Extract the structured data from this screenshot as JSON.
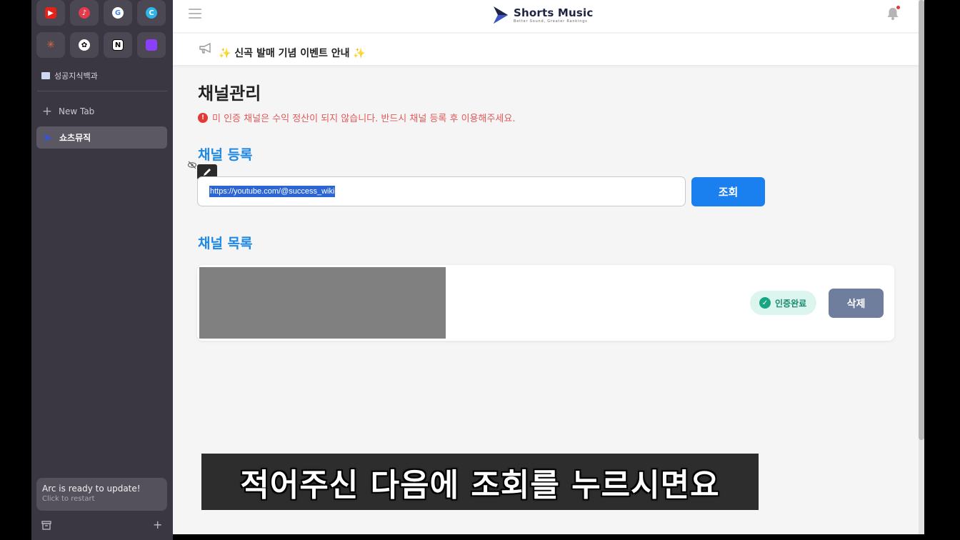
{
  "sidebar": {
    "favorites": [
      {
        "icon": "youtube-icon",
        "color": "#e62117"
      },
      {
        "icon": "music-app-icon",
        "color": "#e23b4b"
      },
      {
        "icon": "google-icon",
        "color": "#ffffff"
      },
      {
        "icon": "canva-icon",
        "color": "#2fb4e8"
      },
      {
        "icon": "claude-icon",
        "color": "#e2683f"
      },
      {
        "icon": "chatgpt-icon",
        "color": "#ffffff"
      },
      {
        "icon": "notion-icon",
        "color": "#ffffff"
      },
      {
        "icon": "purple-app-icon",
        "color": "#8a3ffc"
      }
    ],
    "folder_label": "성공지식백과",
    "new_tab_label": "New Tab",
    "active_tab_label": "쇼츠뮤직",
    "update_title": "Arc is ready to update!",
    "update_subtitle": "Click to restart"
  },
  "header": {
    "brand_name": "Shorts Music",
    "brand_tagline": "Better Sound, Greater Rankings"
  },
  "notice": {
    "text": "✨ 신곡 발매 기념 이벤트 안내 ✨"
  },
  "main": {
    "page_title": "채널관리",
    "warning": "미 인증 채널은 수익 정산이 되지 않습니다. 반드시 채널 등록 후 이용해주세요.",
    "register_title": "채널 등록",
    "url_value": "https://youtube.com/@success_wiki",
    "search_label": "조회",
    "list_title": "채널 목록",
    "channels": [
      {
        "status": "인증완료",
        "delete_label": "삭제"
      }
    ]
  },
  "caption": {
    "text": "적어주신 다음에 조회를 누르시면요"
  },
  "colors": {
    "accent": "#1a7fef",
    "section_title": "#1e88e5",
    "warning": "#e05a5a",
    "verified": "#1aa683",
    "delete": "#6f7e9d"
  }
}
